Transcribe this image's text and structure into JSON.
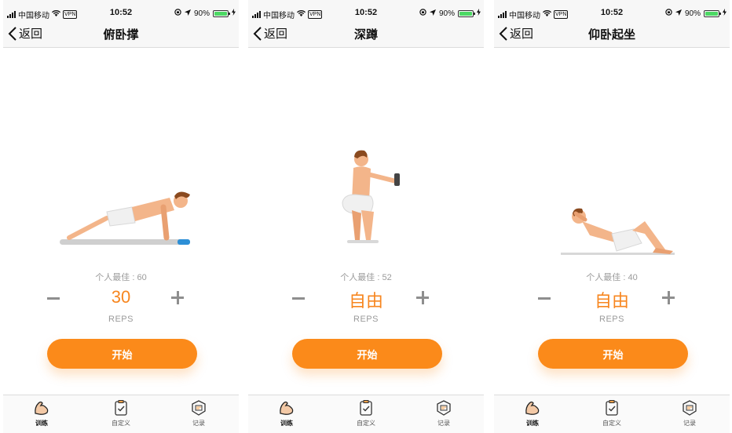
{
  "status_bar": {
    "carrier": "中国移动",
    "vpn": "VPN",
    "time": "10:52",
    "battery": "90%"
  },
  "colors": {
    "accent": "#fb8a1a",
    "count": "#f7861f",
    "skin": "#f3b58a",
    "hair": "#8a4a1f",
    "shorts": "#eeeeee"
  },
  "screens": [
    {
      "back_label": "返回",
      "title": "俯卧撑",
      "illustration": "pushup-figure",
      "best": "个人最佳 : 60",
      "count": "30",
      "unit": "REPS",
      "start_label": "开始"
    },
    {
      "back_label": "返回",
      "title": "深蹲",
      "illustration": "squat-figure",
      "best": "个人最佳 : 52",
      "count": "自由",
      "unit": "REPS",
      "start_label": "开始"
    },
    {
      "back_label": "返回",
      "title": "仰卧起坐",
      "illustration": "situp-figure",
      "best": "个人最佳 : 40",
      "count": "自由",
      "unit": "REPS",
      "start_label": "开始"
    }
  ],
  "tabbar": {
    "items": [
      {
        "label": "训练",
        "icon": "flexed-arm-icon",
        "active": true
      },
      {
        "label": "自定义",
        "icon": "clipboard-check-icon",
        "active": false
      },
      {
        "label": "记录",
        "icon": "record-badge-icon",
        "active": false
      }
    ]
  }
}
